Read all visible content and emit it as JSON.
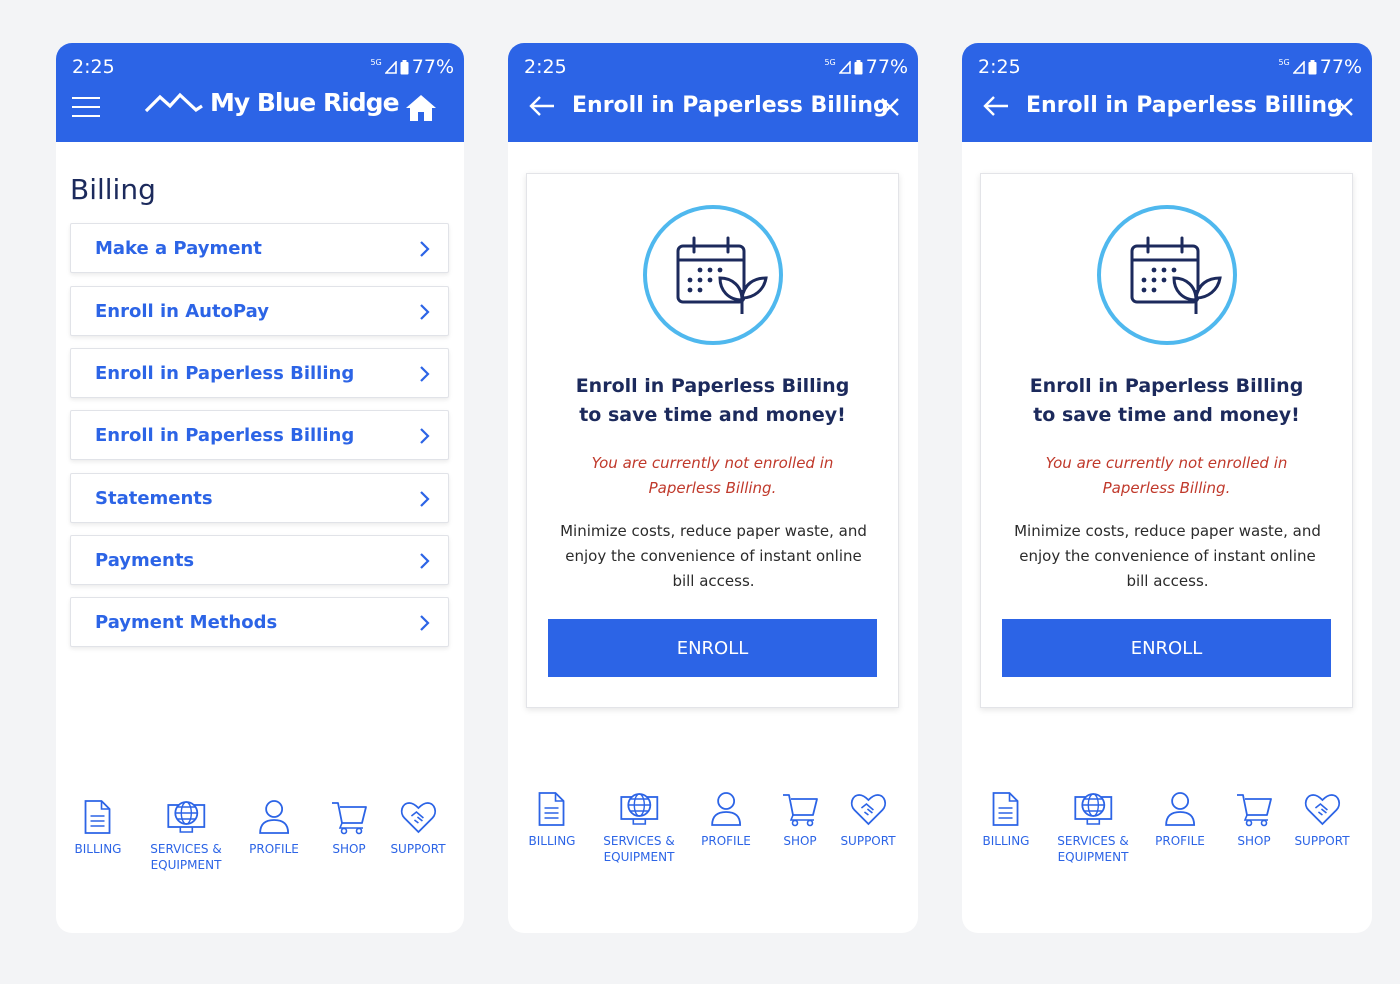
{
  "status": {
    "time": "2:25",
    "network": "5G",
    "battery": "77%"
  },
  "screen1": {
    "brand": "My Blue Ridge",
    "heading": "Billing",
    "menu": [
      {
        "label": "Make a Payment"
      },
      {
        "label": "Enroll in AutoPay"
      },
      {
        "label": "Enroll in Paperless Billing"
      },
      {
        "label": "Enroll in Paperless Billing"
      },
      {
        "label": "Statements"
      },
      {
        "label": "Payments"
      },
      {
        "label": "Payment Methods"
      }
    ]
  },
  "enroll": {
    "title": "Enroll in Paperless Billing",
    "headline_line1": "Enroll in Paperless Billing",
    "headline_line2": "to save time and money!",
    "notice_line1": "You are currently not enrolled in",
    "notice_line2": "Paperless Billing.",
    "desc_line1": "Minimize costs, reduce paper waste, and",
    "desc_line2": "enjoy the convenience of instant online",
    "desc_line3": "bill access.",
    "button": "ENROLL"
  },
  "nav": {
    "billing": "BILLING",
    "services_line1": "SERVICES &",
    "services_line2": "EQUIPMENT",
    "profile": "PROFILE",
    "shop": "SHOP",
    "support": "SUPPORT"
  },
  "colors": {
    "primary": "#2c64e6",
    "navy": "#1c2a5c",
    "alert": "#c0392b",
    "hero_ring": "#4fb8ee"
  }
}
